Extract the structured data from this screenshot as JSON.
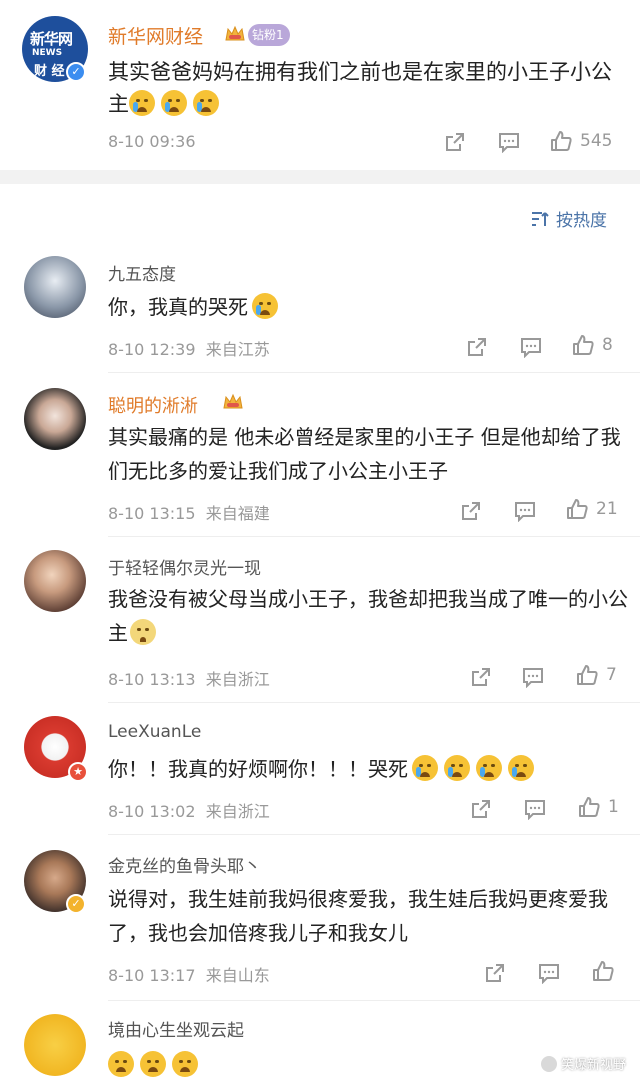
{
  "post": {
    "author": "新华网财经",
    "fan_badge": "钻粉1",
    "avatar_text_top": "新华网",
    "avatar_text_small": "NEWS",
    "avatar_text_bottom": "财 经",
    "text": "其实爸爸妈妈在拥有我们之前也是在家里的小王子小公主",
    "time": "8-10 09:36",
    "like_count": "545",
    "icons": [
      "share-icon",
      "comment-icon",
      "like-icon"
    ]
  },
  "sort": {
    "label": "按热度",
    "icon": "sort-icon"
  },
  "comments": [
    {
      "name": "九五态度",
      "text": "你，我真的哭死",
      "time": "8-10 12:39",
      "location": "来自江苏",
      "likes": "8",
      "name_style": "normal"
    },
    {
      "name": "聪明的淅淅",
      "text": "其实最痛的是 他未必曾经是家里的小王子 但是他却给了我们无比多的爱让我们成了小公主小王子",
      "time": "8-10 13:15",
      "location": "来自福建",
      "likes": "21",
      "name_style": "gold"
    },
    {
      "name": "于轻轻偶尔灵光一现",
      "text": "我爸没有被父母当成小王子，我爸却把我当成了唯一的小公主",
      "time": "8-10 13:13",
      "location": "来自浙江",
      "likes": "7",
      "name_style": "normal"
    },
    {
      "name": "LeeXuanLe",
      "text": "你！！我真的好烦啊你！！！哭死",
      "time": "8-10 13:02",
      "location": "来自浙江",
      "likes": "1",
      "name_style": "normal"
    },
    {
      "name": "金克丝的鱼骨头耶丶",
      "text": "说得对，我生娃前我妈很疼爱我，我生娃后我妈更疼爱我了，我也会加倍疼我儿子和我女儿",
      "time": "8-10 13:17",
      "location": "来自山东",
      "likes": "",
      "name_style": "normal"
    },
    {
      "name": "境由心生坐观云起",
      "text": "",
      "time": "",
      "location": "",
      "likes": "",
      "name_style": "normal"
    }
  ],
  "watermark": "笑爆新视野",
  "colors": {
    "gold_name": "#e07b2a",
    "link_blue": "#4b74a8",
    "meta_gray": "#999999",
    "band_gray": "#f2f2f2"
  }
}
